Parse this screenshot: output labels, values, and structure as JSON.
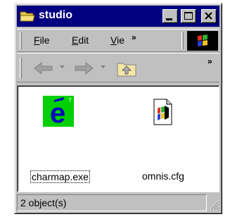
{
  "window": {
    "title": "studio"
  },
  "menu": {
    "items": [
      {
        "label": "File",
        "underline": "F",
        "rest": "ile"
      },
      {
        "label": "Edit",
        "underline": "E",
        "rest": "dit"
      },
      {
        "label": "Vie",
        "underline": "V",
        "rest": "ie"
      }
    ],
    "overflow": "»"
  },
  "toolbar": {
    "overflow": "»"
  },
  "files": [
    {
      "name": "charmap.exe",
      "icon": "charmap-e-icon",
      "selected": true
    },
    {
      "name": "omnis.cfg",
      "icon": "config-file-icon",
      "selected": false
    }
  ],
  "status": {
    "text": "2 object(s)"
  },
  "colors": {
    "titlebar": "#000080",
    "chrome": "#c0c0c0",
    "charmap_bg": "#00d000",
    "charmap_e": "#0000c0"
  }
}
